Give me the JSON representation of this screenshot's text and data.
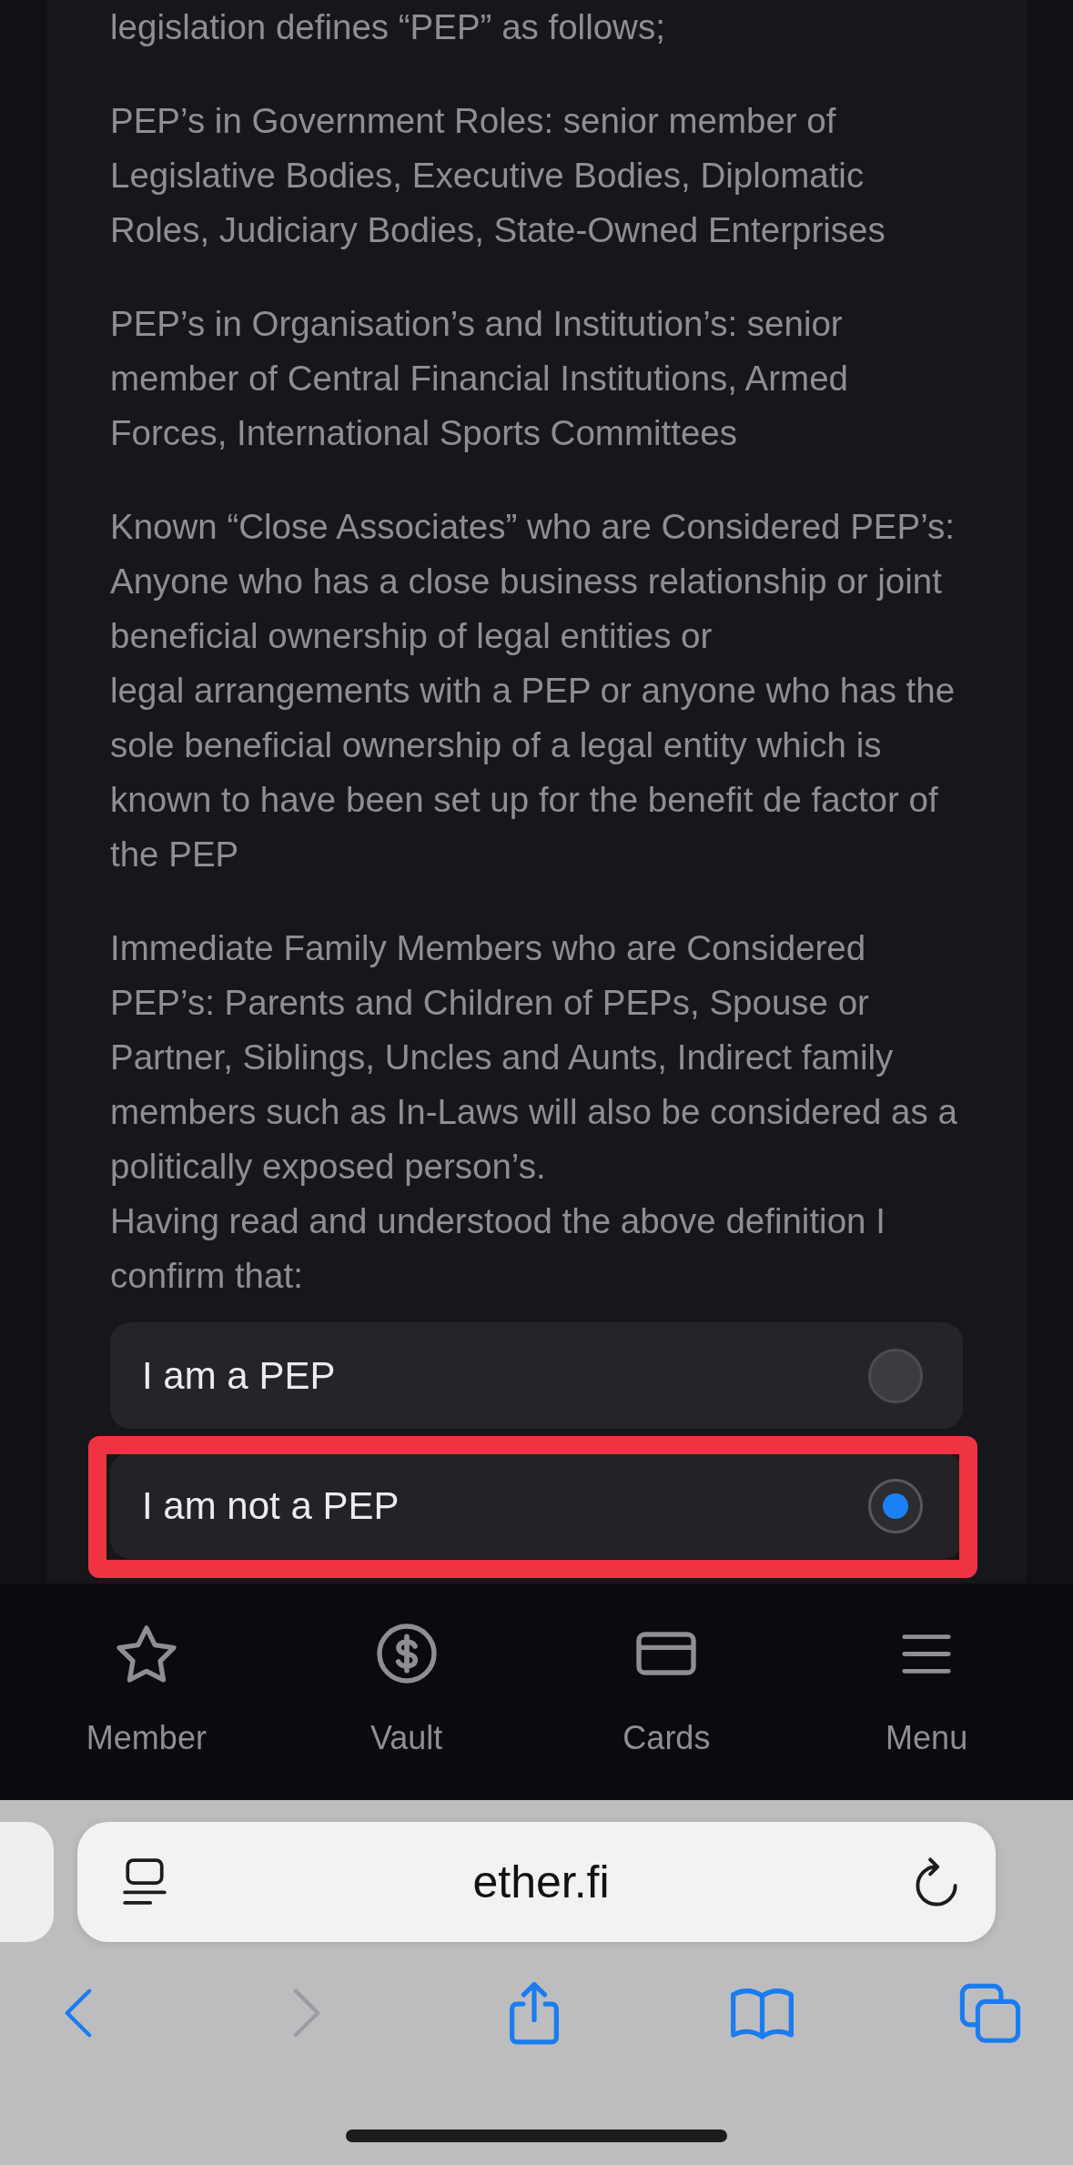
{
  "content": {
    "paragraphs": [
      "legislation defines “PEP” as follows;",
      "PEP’s in Government Roles: senior member of Legislative Bodies, Executive Bodies, Diplomatic Roles, Judiciary Bodies, State-Owned Enterprises",
      "PEP’s in Organisation’s and Institution’s: senior member of Central Financial Institutions, Armed Forces, International Sports Committees",
      "Known “Close Associates” who are Considered PEP’s: Anyone who has a close business relationship or joint beneficial ownership of legal entities or\nlegal arrangements with a PEP or anyone who has the sole beneficial ownership of a legal entity which is known to have been set up for the benefit de factor of the PEP",
      "Immediate Family Members who are Considered PEP’s: Parents and Children of PEPs, Spouse or Partner, Siblings, Uncles and Aunts, Indirect family members such as In-Laws will also be considered as a politically exposed person’s.\nHaving read and understood the above definition I confirm that:"
    ]
  },
  "options": [
    {
      "label": "I am a PEP",
      "selected": false,
      "highlighted": false
    },
    {
      "label": "I am not a PEP",
      "selected": true,
      "highlighted": true
    }
  ],
  "bottom_nav": [
    {
      "label": "Member",
      "kind": "member"
    },
    {
      "label": "Vault",
      "kind": "vault"
    },
    {
      "label": "Cards",
      "kind": "cards"
    },
    {
      "label": "Menu",
      "kind": "menu"
    }
  ],
  "browser": {
    "url": "ether.fi",
    "toolbar": [
      {
        "kind": "back",
        "disabled": false
      },
      {
        "kind": "forward",
        "disabled": true
      },
      {
        "kind": "share",
        "disabled": false
      },
      {
        "kind": "bookmarks",
        "disabled": false
      },
      {
        "kind": "tabs",
        "disabled": false
      }
    ]
  }
}
